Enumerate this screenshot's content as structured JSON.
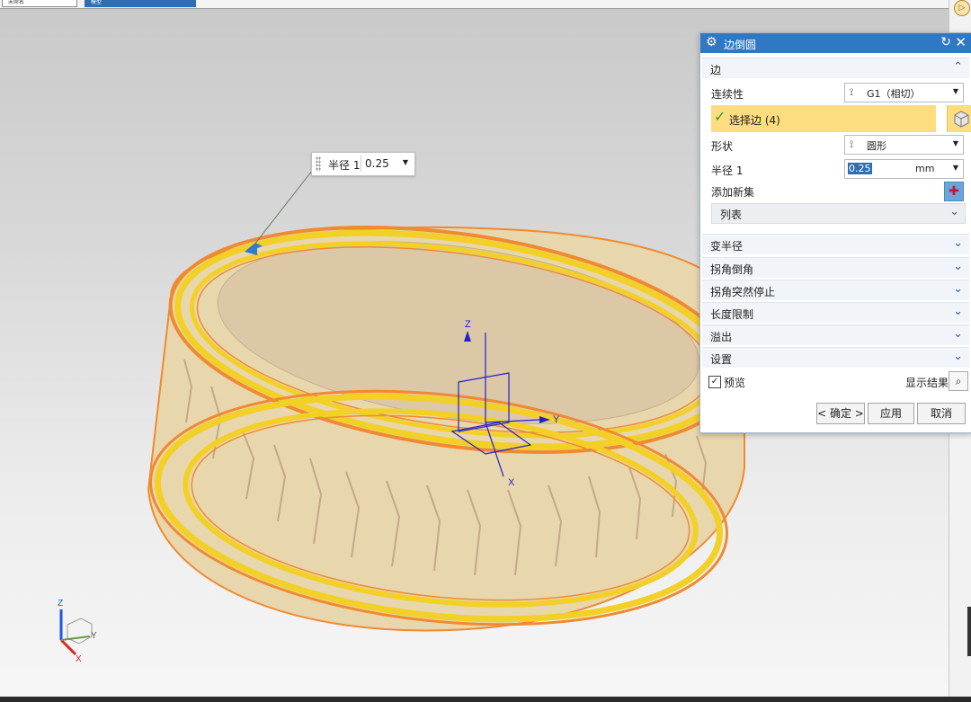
{
  "tabs": [
    {
      "label": "未命名"
    },
    {
      "label": "模型"
    }
  ],
  "radius_callout": {
    "label": "半径 1",
    "value": "0.25"
  },
  "dialog": {
    "title": "边倒圆",
    "edge_section": {
      "title": "边",
      "continuity_label": "连续性",
      "continuity_value": "G1（相切）",
      "select_edge": "选择边 (4)",
      "shape_label": "形状",
      "shape_value": "圆形",
      "radius_label": "半径 1",
      "radius_value": "0.25",
      "radius_unit": "mm",
      "add_new_set": "添加新集",
      "list": "列表"
    },
    "sections": [
      {
        "label": "变半径"
      },
      {
        "label": "拐角倒角"
      },
      {
        "label": "拐角突然停止"
      },
      {
        "label": "长度限制"
      },
      {
        "label": "溢出"
      },
      {
        "label": "设置"
      }
    ],
    "preview_label": "预览",
    "show_result_label": "显示结果",
    "ok_label": "< 确定 >",
    "apply_label": "应用",
    "cancel_label": "取消"
  },
  "axes": {
    "x": "X",
    "y": "Y",
    "z": "Z"
  },
  "colors": {
    "title_bar": "#2f78c4",
    "selection": "#fddd7f",
    "ring_highlight": "#f2d026",
    "edge_orange": "#f08a30",
    "body_tan": "#e8d6ad"
  }
}
